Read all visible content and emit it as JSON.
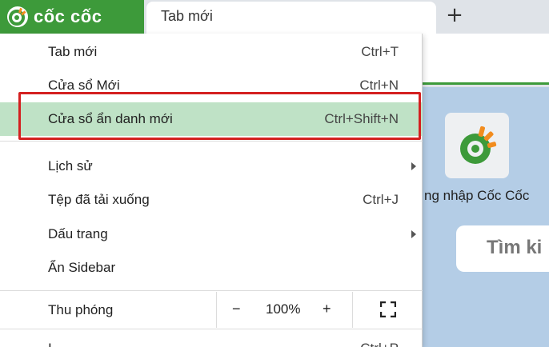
{
  "browser": {
    "brand_name": "cốc cốc",
    "tab_title": "Tab mới",
    "new_tab_symbol": "+"
  },
  "menu": {
    "items": [
      {
        "label": "Tab mới",
        "shortcut": "Ctrl+T"
      },
      {
        "label": "Cửa sổ Mới",
        "shortcut": "Ctrl+N"
      },
      {
        "label": "Cửa sổ ẩn danh mới",
        "shortcut": "Ctrl+Shift+N"
      },
      {
        "label": "Lịch sử",
        "shortcut": ""
      },
      {
        "label": "Tệp đã tải xuống",
        "shortcut": "Ctrl+J"
      },
      {
        "label": "Dấu trang",
        "shortcut": ""
      },
      {
        "label": "Ẩn Sidebar",
        "shortcut": ""
      }
    ],
    "zoom": {
      "label": "Thu phóng",
      "minus": "−",
      "value": "100%",
      "plus": "+"
    },
    "cut_item": {
      "label": "I",
      "shortcut": "Ctrl+P"
    }
  },
  "page": {
    "shortcut_label": "ng nhập Cốc Cốc",
    "search_placeholder": "Tìm ki"
  },
  "colors": {
    "brand_green": "#3d9a3a",
    "highlight_bg": "#bfe2c6",
    "highlight_frame": "#d42020",
    "content_bg": "#b4cde6"
  }
}
